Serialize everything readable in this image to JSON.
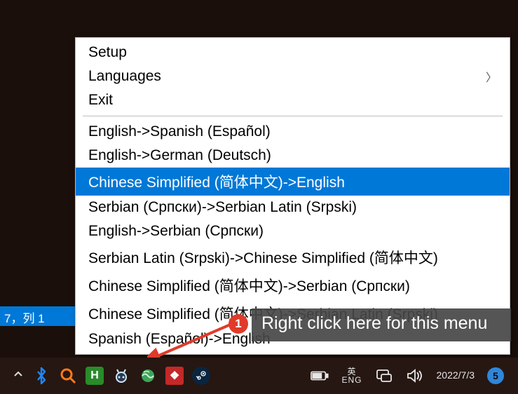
{
  "menu": {
    "setup": "Setup",
    "languages": "Languages",
    "exit": "Exit",
    "pairs": [
      "English->Spanish (Español)",
      "English->German (Deutsch)",
      "Chinese Simplified (简体中文)->English",
      "Serbian (Српски)->Serbian Latin (Srpski)",
      "English->Serbian (Српски)",
      "Serbian Latin (Srpski)->Chinese Simplified (简体中文)",
      "Chinese Simplified (简体中文)->Serbian (Српски)",
      "Chinese Simplified (简体中文)->Serbian Latin (Srpski)",
      "Spanish (Español)->English"
    ],
    "selected_index": 2
  },
  "status": {
    "left_text": "7，列 1"
  },
  "annotation": {
    "number": "1",
    "text": "Right click here for this menu"
  },
  "taskbar": {
    "ime_top": "英",
    "ime_bottom": "ENG",
    "date": "2022/7/3",
    "notif_count": "5"
  }
}
